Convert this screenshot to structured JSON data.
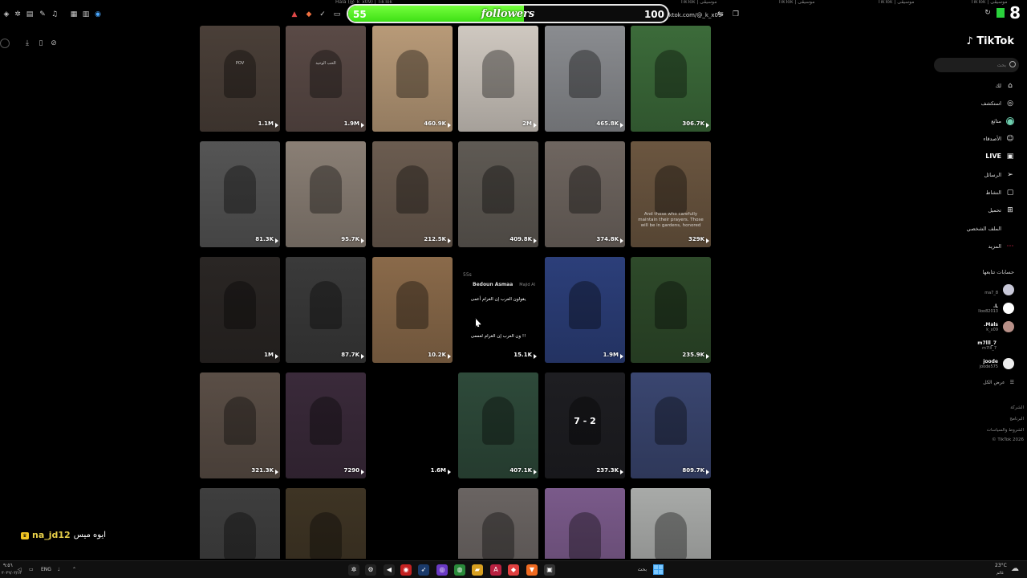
{
  "browser": {
    "url": "tiktok.com/@_k_x09",
    "tabs": [
      "Hala (@_k_x09) | TikTok",
      "TikTok | موسيقى",
      "TikTok | موسيقى",
      "TikTok | موسيقى",
      "TikTok | موسيقى"
    ]
  },
  "overlay": {
    "followers_current": "55",
    "followers_label": "followers",
    "followers_goal": "100",
    "progress_fraction": 0.55,
    "app_badge": "8"
  },
  "videos": [
    {
      "views": "1.1M",
      "bg": "#4a3f38",
      "caption": "POV"
    },
    {
      "views": "1.9M",
      "bg": "#5a4a46",
      "caption": "الحب الوحيد"
    },
    {
      "views": "460.9K",
      "bg": "#b89a78",
      "caption": ""
    },
    {
      "views": "2M",
      "bg": "#cfc8c0",
      "caption": ""
    },
    {
      "views": "465.8K",
      "bg": "#8a8c90",
      "caption": ""
    },
    {
      "views": "306.7K",
      "bg": "#3c6b3a",
      "caption": ""
    },
    {
      "views": "81.3K",
      "bg": "#555555",
      "caption": ""
    },
    {
      "views": "95.7K",
      "bg": "#8a7f75",
      "caption": ""
    },
    {
      "views": "212.5K",
      "bg": "#6b5c50",
      "caption": ""
    },
    {
      "views": "409.8K",
      "bg": "#5f5a54",
      "caption": ""
    },
    {
      "views": "374.8K",
      "bg": "#6f6660",
      "caption": ""
    },
    {
      "views": "329K",
      "bg": "#6b5640",
      "caption": "And those who carefully maintain their prayers. Those will be in gardens, honored"
    },
    {
      "views": "1M",
      "bg": "#2a2624",
      "caption": ""
    },
    {
      "views": "87.7K",
      "bg": "#3a3a3a",
      "caption": ""
    },
    {
      "views": "10.2K",
      "bg": "#8a6a4a",
      "caption": ""
    },
    {
      "views": "15.1K",
      "bg": "#000000",
      "caption": "يقولون العرب إن الغرام أعمى",
      "author": "Bedoun Asmaa",
      "handle": "Majid Al",
      "time": "55s",
      "text2": "ون العرب إن الغرام لعممى !!"
    },
    {
      "views": "1.9M",
      "bg": "#2c3f7a",
      "caption": ""
    },
    {
      "views": "235.9K",
      "bg": "#2e4a2a",
      "caption": ""
    },
    {
      "views": "321.3K",
      "bg": "#5a4e46",
      "caption": ""
    },
    {
      "views": "7290",
      "bg": "#3a2a3a",
      "caption": ""
    },
    {
      "views": "1.6M",
      "bg": "#000000",
      "caption": ""
    },
    {
      "views": "407.1K",
      "bg": "#2e4a3a",
      "caption": ""
    },
    {
      "views": "237.3K",
      "bg": "#1e1e22",
      "caption": "",
      "score": "7 - 2"
    },
    {
      "views": "809.7K",
      "bg": "#3a4670",
      "caption": ""
    },
    {
      "views": "",
      "bg": "#3e3e3e",
      "caption": ""
    },
    {
      "views": "",
      "bg": "#3e3424",
      "caption": ""
    },
    {
      "views": "",
      "bg": "#000000",
      "caption": ""
    },
    {
      "views": "",
      "bg": "#6a6462",
      "caption": ""
    },
    {
      "views": "",
      "bg": "#7a5a8a",
      "caption": ""
    },
    {
      "views": "",
      "bg": "#a8aaa8",
      "caption": ""
    }
  ],
  "sidebar": {
    "logo": "TikTok",
    "search_placeholder": "بحث",
    "nav": [
      {
        "label": "لك",
        "icon": "home-icon",
        "glyph": "⌂"
      },
      {
        "label": "استكشف",
        "icon": "compass-icon",
        "glyph": "◎"
      },
      {
        "label": "متابَع",
        "icon": "following-avatar-icon",
        "glyph": "●"
      },
      {
        "label": "الأصدقاء",
        "icon": "friends-icon",
        "glyph": "☺"
      },
      {
        "label": "LIVE",
        "icon": "live-icon",
        "glyph": "▣"
      },
      {
        "label": "الرسائل",
        "icon": "messages-icon",
        "glyph": "➢"
      },
      {
        "label": "النشاط",
        "icon": "activity-icon",
        "glyph": "▢"
      },
      {
        "label": "تحميل",
        "icon": "upload-icon",
        "glyph": "⊞"
      },
      {
        "label": "الملف الشخصي",
        "icon": "profile-icon",
        "glyph": ""
      },
      {
        "label": "المزيد",
        "icon": "more-icon",
        "glyph": "⋯"
      }
    ],
    "following_header": "حسابات تتابعها",
    "accounts": [
      {
        "name": "⁠",
        "handle": "ma7_8",
        "avatar_color": "#c8c8d8"
      },
      {
        "name": ".L",
        "handle": "lloo82013",
        "avatar_color": "#ffffff"
      },
      {
        "name": ".Mals",
        "handle": "k_x09",
        "avatar_color": "#b89088"
      },
      {
        "name": "m7lll_7",
        "handle": "m7lll_7",
        "avatar_color": ""
      },
      {
        "name": "joode",
        "handle": "joode575",
        "avatar_color": "#eeeeee"
      }
    ],
    "see_all": "عرض الكل",
    "footer": [
      "الشركة",
      "البرنامج",
      "الشروط والسياسات",
      "© TikTok 2026"
    ]
  },
  "chat": {
    "user": "na_jd12",
    "message": "ايوه ميس"
  },
  "taskbar": {
    "time": "٩:٥٦",
    "date": "٢٠٢٦/٠٢/١٢",
    "lang": "ENG",
    "search_label": "بحث",
    "weather": "23°C",
    "weather_desc": "غائم"
  }
}
